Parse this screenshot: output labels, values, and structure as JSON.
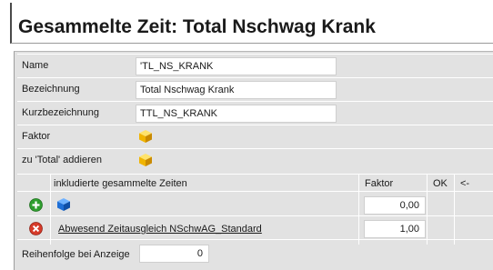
{
  "title": "Gesammelte Zeit: Total Nschwag Krank",
  "fields": {
    "name": {
      "label": "Name",
      "value": "'TL_NS_KRANK"
    },
    "bezeichnung": {
      "label": "Bezeichnung",
      "value": "Total Nschwag Krank"
    },
    "kurzbezeichnung": {
      "label": "Kurzbezeichnung",
      "value": "TTL_NS_KRANK"
    },
    "faktor": {
      "label": "Faktor",
      "icon": "yellow-cube-icon"
    },
    "total": {
      "label": "zu 'Total' addieren",
      "icon": "yellow-cube-icon"
    }
  },
  "grid": {
    "headers": {
      "name": "inkludierte gesammelte Zeiten",
      "faktor": "Faktor",
      "ok": "OK",
      "nav": "<-"
    },
    "new_row": {
      "icon_add": "green-plus-icon",
      "icon_item": "blue-cube-icon",
      "faktor": "0,00"
    },
    "rows": [
      {
        "icon_delete": "red-x-icon",
        "name": "Abwesend Zeitausgleich NSchwAG_Standard",
        "faktor": "1,00"
      }
    ]
  },
  "reihenfolge": {
    "label": "Reihenfolge bei Anzeige",
    "value": "0"
  },
  "colors": {
    "panel": "#e2e2e2",
    "add": "#2f9e2f",
    "delete": "#d63b2a",
    "cube_yellow": "#f0b400",
    "cube_blue": "#1e6fd6"
  }
}
